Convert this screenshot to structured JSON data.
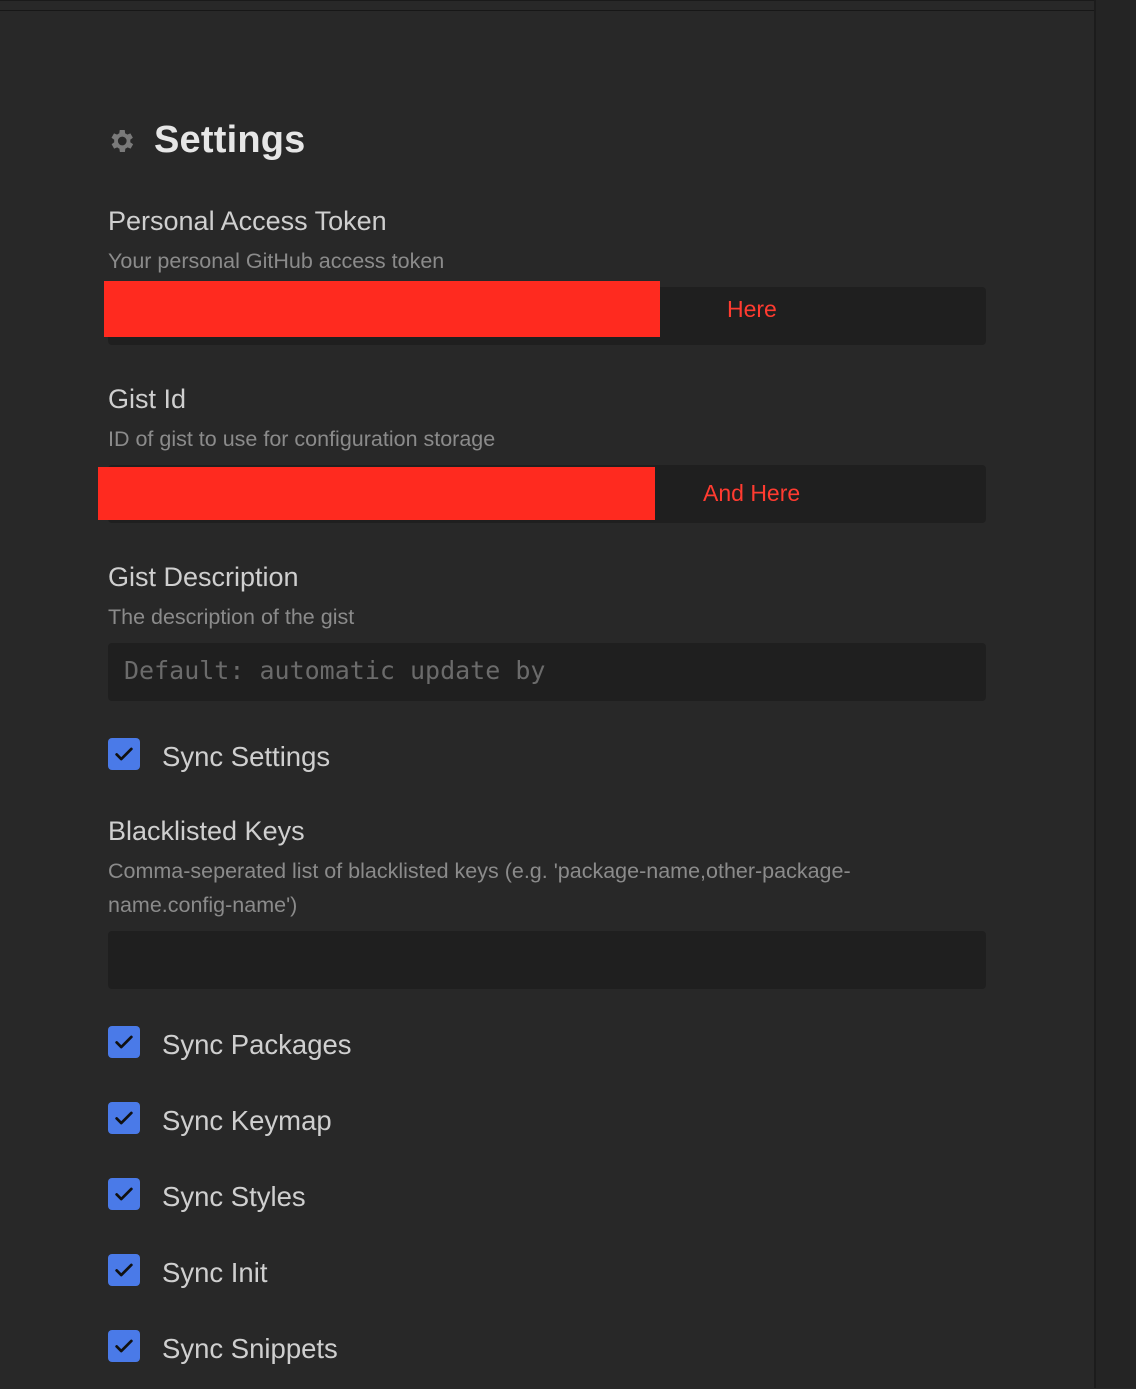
{
  "settings": {
    "title": "Settings",
    "icon": "gear-icon"
  },
  "token": {
    "label": "Personal Access Token",
    "description": "Your personal GitHub access token",
    "annotation": "Here"
  },
  "gist_id": {
    "label": "Gist Id",
    "description": "ID of gist to use for configuration storage",
    "annotation": "And Here"
  },
  "gist_description": {
    "label": "Gist Description",
    "description": "The description of the gist",
    "placeholder": "Default: automatic update by"
  },
  "sync_settings": {
    "label": "Sync Settings",
    "checked": true
  },
  "blacklisted_keys": {
    "label": "Blacklisted Keys",
    "description": "Comma-seperated list of blacklisted keys (e.g. 'package-name,other-package-name.config-name')",
    "value": ""
  },
  "checkboxes": [
    {
      "label": "Sync Packages",
      "checked": true
    },
    {
      "label": "Sync Keymap",
      "checked": true
    },
    {
      "label": "Sync Styles",
      "checked": true
    },
    {
      "label": "Sync Init",
      "checked": true
    },
    {
      "label": "Sync Snippets",
      "checked": true
    }
  ],
  "colors": {
    "background": "#282828",
    "input": "#1f1f1f",
    "checkbox": "#4a7ae8",
    "redaction": "#ff2a1f",
    "annotation": "#ff3b30"
  }
}
